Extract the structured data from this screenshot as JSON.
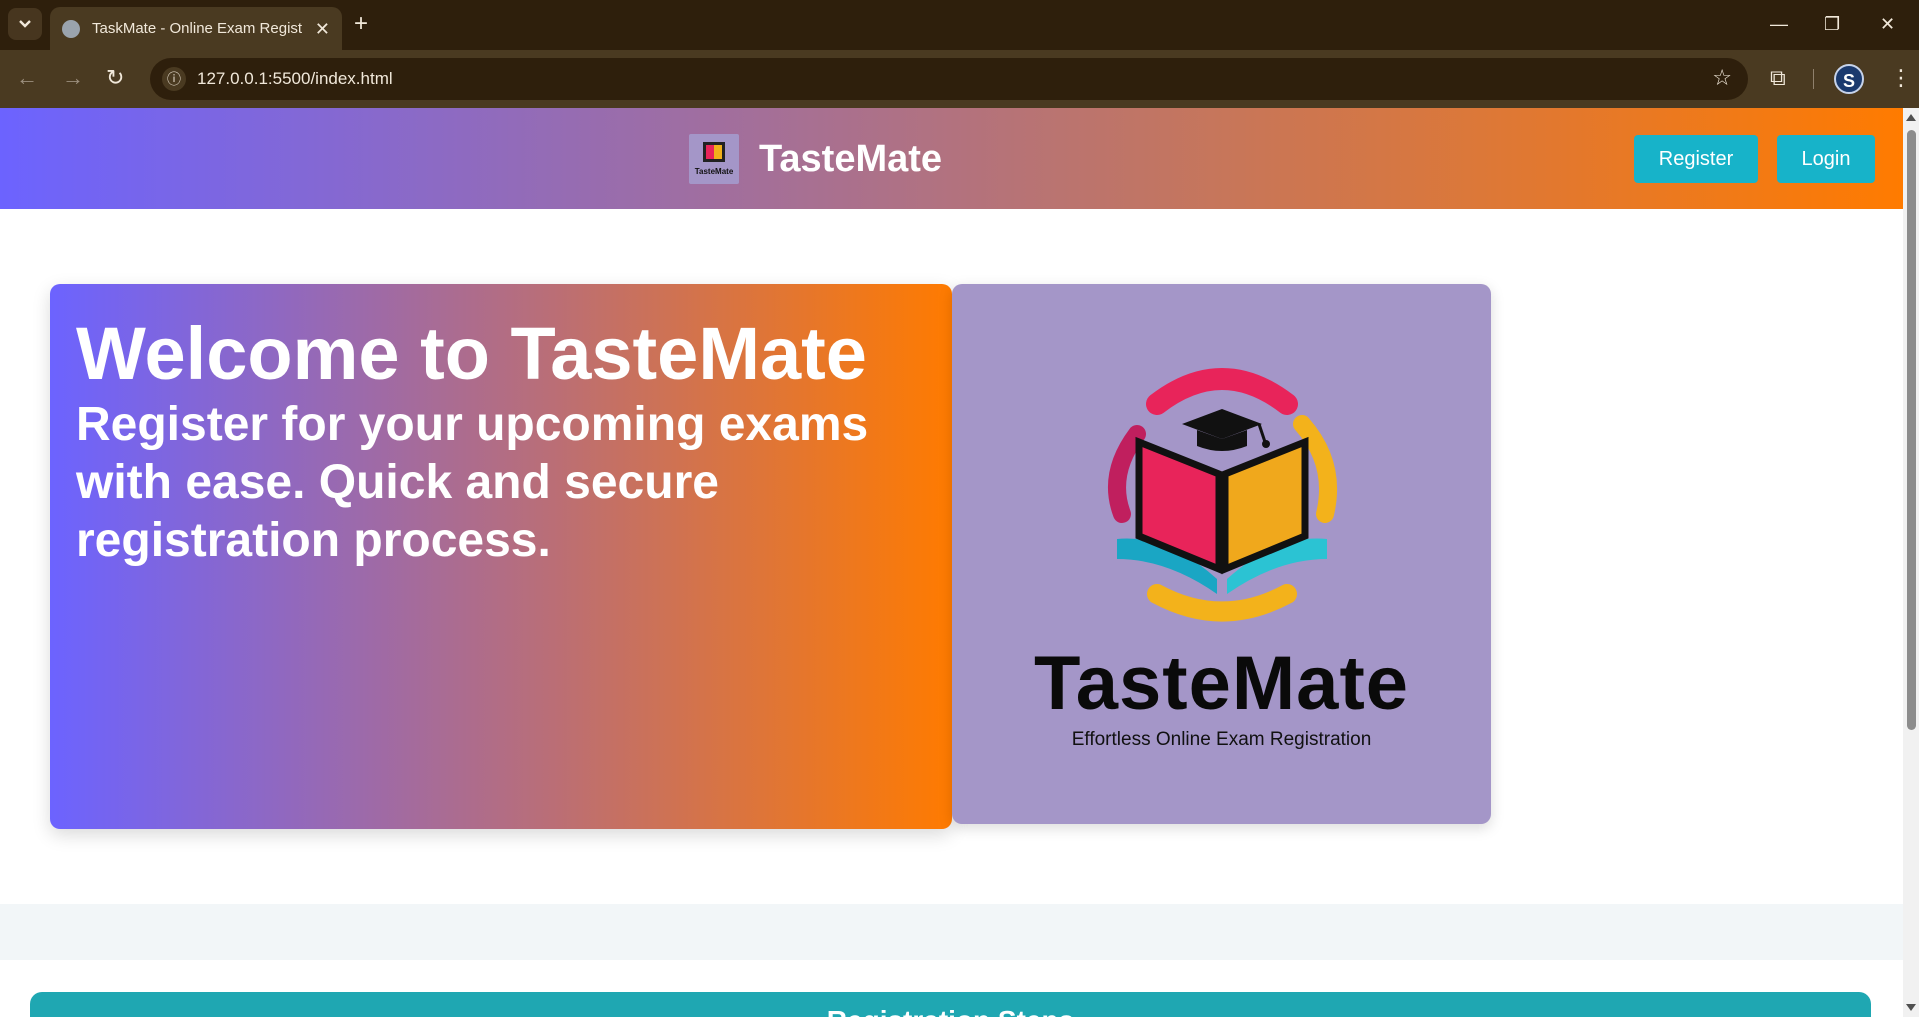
{
  "browser": {
    "tab_title": "TaskMate - Online Exam Registration",
    "tab_close": "✕",
    "new_tab": "+",
    "url": "127.0.0.1:5500/index.html",
    "profile_initial": "S",
    "controls": {
      "minimize": "—",
      "restore": "❐",
      "close": "✕"
    }
  },
  "header": {
    "brand_name": "TasteMate",
    "logo_mini_text": "TasteMate",
    "register_label": "Register",
    "login_label": "Login"
  },
  "hero": {
    "title": "Welcome to TasteMate",
    "subtitle": "Register for your upcoming exams with ease. Quick and secure registration process."
  },
  "logo_card": {
    "wordmark": "TasteMate",
    "tagline": "Effortless Online Exam Registration"
  },
  "steps": {
    "title": "Registration Steps"
  },
  "colors": {
    "header_gradient_start": "#6c63ff",
    "header_gradient_end": "#ff7b00",
    "button_teal": "#17b3c9",
    "logo_card_bg": "#a496c8",
    "steps_bg": "#1fa7b2"
  }
}
